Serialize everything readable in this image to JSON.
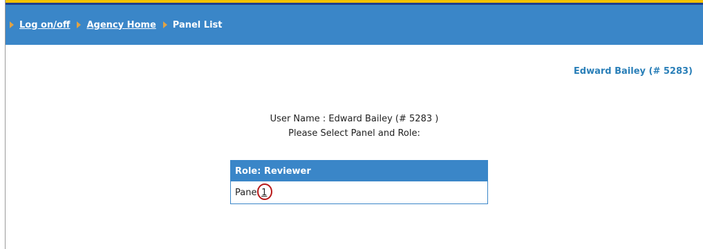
{
  "breadcrumb": {
    "items": [
      {
        "label": "Log on/off",
        "link": true
      },
      {
        "label": "Agency Home",
        "link": true
      },
      {
        "label": "Panel List",
        "link": false
      }
    ]
  },
  "header": {
    "user": "Edward Bailey (# 5283)"
  },
  "main": {
    "user_line": "User Name : Edward Bailey (# 5283 )",
    "instruction": "Please Select Panel and Role:"
  },
  "panel_table": {
    "role_header": "Role: Reviewer",
    "row_label": "Panel",
    "row_link": "1"
  },
  "colors": {
    "navbar": "#3a86c8",
    "accent_text": "#2a7fb8",
    "highlight": "#b81818"
  }
}
